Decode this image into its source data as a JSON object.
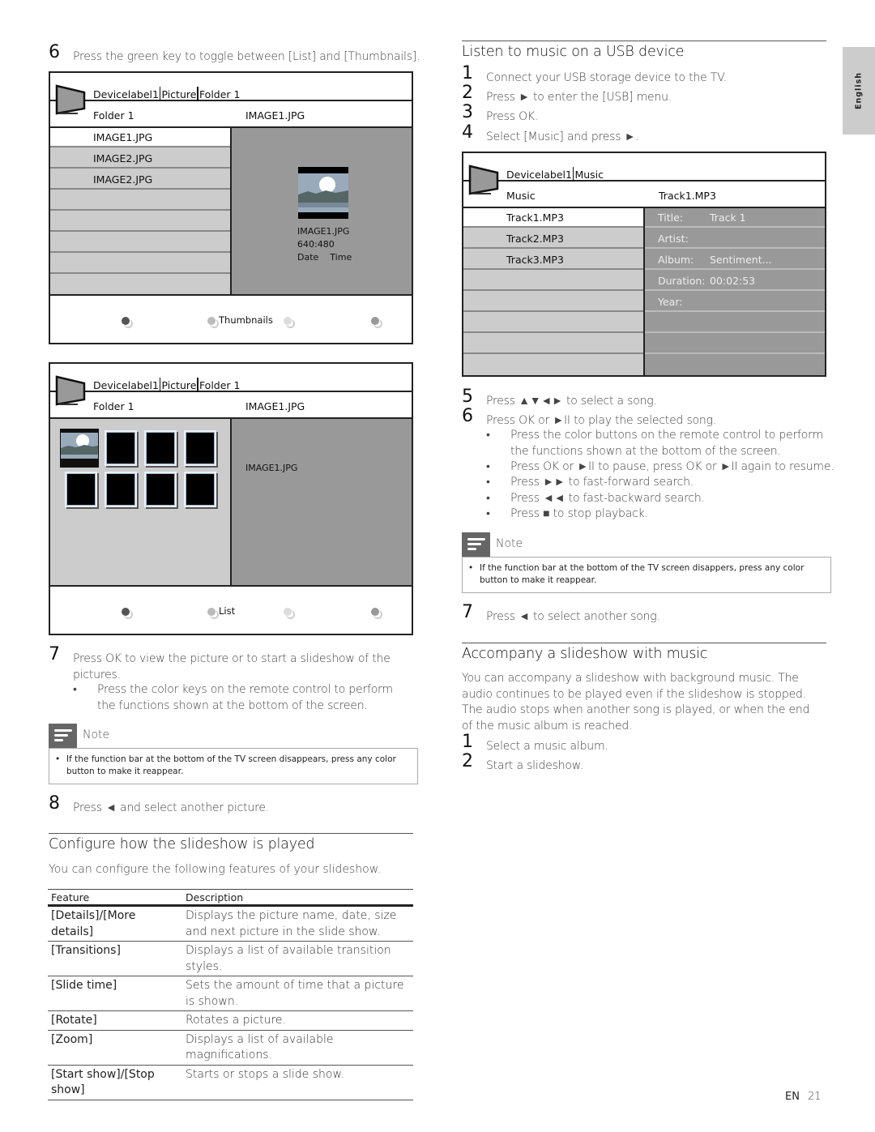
{
  "side_tab": {
    "label": "English"
  },
  "footer": {
    "lang": "EN",
    "page": "21"
  },
  "left": {
    "step6": {
      "num": "6",
      "text": "Press the green key to toggle between [List] and [Thumbnails]."
    },
    "screen_list": {
      "breadcrumb": [
        "Devicelabel1",
        "Picture",
        "Folder 1"
      ],
      "folder": "Folder 1",
      "current_file": "IMAGE1.JPG",
      "files": [
        "IMAGE1.JPG",
        "IMAGE2.JPG",
        "IMAGE2.JPG",
        "",
        "",
        "",
        ""
      ],
      "preview": {
        "name": "IMAGE1.JPG",
        "resolution": "640:480",
        "date": "Date",
        "time": "Time"
      },
      "function_label": "Thumbnails",
      "button_colors": [
        "#555555",
        "#bbbbbb",
        "#dddddd",
        "#999999"
      ]
    },
    "screen_thumbs": {
      "breadcrumb": [
        "Devicelabel1",
        "Picture",
        "Folder 1"
      ],
      "folder": "Folder 1",
      "current_file": "IMAGE1.JPG",
      "preview_name": "IMAGE1.JPG",
      "thumb_count": 8,
      "function_label": "List",
      "button_colors": [
        "#555555",
        "#bbbbbb",
        "#dddddd",
        "#999999"
      ]
    },
    "step7": {
      "num": "7",
      "text": "Press OK to view the picture or to start a slideshow of the pictures."
    },
    "step7_bullet": "Press the color keys on the remote control to perform the functions shown at the bottom of the screen.",
    "note": {
      "title": "Note",
      "text": "If the function bar at the bottom of the TV screen disappears, press any color button to make it reappear."
    },
    "step8": {
      "num": "8",
      "text": "Press ◄ and select another picture."
    },
    "config": {
      "heading": "Configure how the slideshow is played",
      "intro": "You can configure the following features of your slideshow.",
      "table": {
        "headers": [
          "Feature",
          "Description"
        ],
        "rows": [
          [
            "[Details]/[More details]",
            "Displays the picture name, date, size and next picture in the slide show."
          ],
          [
            "[Transitions]",
            "Displays a list of available transition styles."
          ],
          [
            "[Slide time]",
            "Sets the amount of time that a picture is shown."
          ],
          [
            "[Rotate]",
            "Rotates a picture."
          ],
          [
            "[Zoom]",
            "Displays a list of available magnifications."
          ],
          [
            "[Start show]/[Stop show]",
            "Starts or stops a slide show."
          ]
        ]
      }
    }
  },
  "right": {
    "music": {
      "heading": "Listen to music on a USB device",
      "steps": [
        {
          "num": "1",
          "text": "Connect your USB storage device to the TV."
        },
        {
          "num": "2",
          "text": "Press ► to enter the [USB] menu."
        },
        {
          "num": "3",
          "text": "Press OK."
        },
        {
          "num": "4",
          "text": "Select [Music] and press ►."
        }
      ]
    },
    "screen_music": {
      "breadcrumb": [
        "Devicelabel1",
        "Music"
      ],
      "folder": "Music",
      "current_file": "Track1.MP3",
      "tracks": [
        "Track1.MP3",
        "Track2.MP3",
        "Track3.MP3",
        "",
        "",
        "",
        "",
        ""
      ],
      "info": [
        {
          "key": "Title:",
          "value": "Track 1"
        },
        {
          "key": "Artist:",
          "value": ""
        },
        {
          "key": "Album:",
          "value": "Sentiment..."
        },
        {
          "key": "Duration:",
          "value": "00:02:53"
        },
        {
          "key": "Year:",
          "value": ""
        },
        {
          "key": "",
          "value": ""
        },
        {
          "key": "",
          "value": ""
        },
        {
          "key": "",
          "value": ""
        }
      ]
    },
    "step5": {
      "num": "5",
      "text": "Press ▲▼◄► to select a song."
    },
    "step6": {
      "num": "6",
      "text": "Press OK or ►II to play the selected song."
    },
    "step6_bullets": [
      "Press the color buttons on the remote control to perform the functions shown at the bottom of the screen.",
      "Press OK or ►II to pause, press OK or ►II again to resume.",
      "Press ►► to fast-forward search.",
      "Press ◄◄ to fast-backward search.",
      "Press ■ to stop playback."
    ],
    "note": {
      "title": "Note",
      "text": "If the function bar at the bottom of the TV screen disappers, press any color button to make it reappear."
    },
    "step7": {
      "num": "7",
      "text": "Press ◄ to select another song."
    },
    "accompany": {
      "heading": "Accompany a slideshow with music",
      "intro": "You can accompany a slideshow with background music. The audio continues to be played even if the slideshow is stopped. The audio stops when another song is played, or when the end of the music album is reached.",
      "steps": [
        {
          "num": "1",
          "text": "Select a music album."
        },
        {
          "num": "2",
          "text": "Start a slideshow."
        }
      ]
    }
  }
}
